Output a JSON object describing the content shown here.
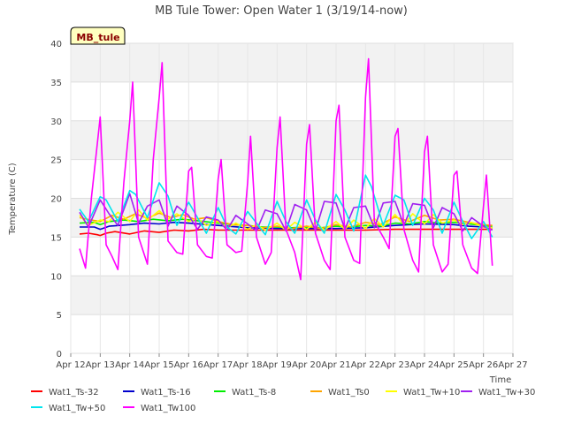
{
  "chart_data": {
    "type": "line",
    "title": "MB Tule Tower: Open Water 1 (3/19/14-now)",
    "xlabel": "Time",
    "ylabel": "Temperature (C)",
    "ylim": [
      0,
      40
    ],
    "xlim": [
      12,
      27
    ],
    "y_ticks": [
      "0",
      "5",
      "10",
      "15",
      "20",
      "25",
      "30",
      "35",
      "40"
    ],
    "x_ticks": [
      "Apr 12",
      "Apr 13",
      "Apr 14",
      "Apr 15",
      "Apr 16",
      "Apr 17",
      "Apr 18",
      "Apr 19",
      "Apr 20",
      "Apr 21",
      "Apr 22",
      "Apr 23",
      "Apr 24",
      "Apr 25",
      "Apr 26",
      "Apr 27"
    ],
    "station_label": "MB_tule",
    "grid": true,
    "legend_position": "bottom",
    "series": [
      {
        "name": "Wat1_Ts-32",
        "color": "#ff0000",
        "x": [
          12.3,
          12.6,
          12.9,
          13.0,
          13.2,
          13.5,
          14.0,
          14.5,
          15.0,
          15.5,
          16.0,
          16.5,
          17.0,
          18.0,
          19.0,
          20.0,
          21.0,
          22.0,
          23.0,
          24.0,
          25.0,
          25.5,
          26.0,
          26.3
        ],
        "y": [
          15.4,
          15.5,
          15.3,
          15.2,
          15.5,
          15.7,
          15.4,
          15.8,
          15.6,
          15.9,
          15.8,
          16.0,
          15.9,
          15.9,
          15.9,
          15.9,
          15.9,
          15.9,
          16.0,
          16.0,
          16.0,
          16.0,
          16.0,
          16.0
        ]
      },
      {
        "name": "Wat1_Ts-16",
        "color": "#0000cc",
        "x": [
          12.3,
          12.8,
          13.0,
          13.3,
          14.0,
          14.5,
          15.0,
          15.5,
          16.0,
          17.0,
          18.0,
          19.0,
          20.0,
          21.0,
          22.0,
          23.0,
          24.0,
          25.0,
          25.5,
          26.0,
          26.3
        ],
        "y": [
          16.3,
          16.3,
          16.0,
          16.4,
          16.6,
          16.8,
          16.7,
          16.9,
          16.8,
          16.5,
          16.2,
          16.1,
          16.1,
          16.1,
          16.2,
          16.5,
          16.7,
          16.6,
          16.4,
          16.3,
          16.2
        ]
      },
      {
        "name": "Wat1_Ts-8",
        "color": "#00ee00",
        "x": [
          12.3,
          12.8,
          13.0,
          13.3,
          13.8,
          14.3,
          14.8,
          15.3,
          15.8,
          16.3,
          17.0,
          17.5,
          18.0,
          18.5,
          19.0,
          19.5,
          20.0,
          20.5,
          21.0,
          21.5,
          22.0,
          22.5,
          23.0,
          23.5,
          24.0,
          24.5,
          25.0,
          25.5,
          26.0,
          26.3
        ],
        "y": [
          16.8,
          16.9,
          16.6,
          17.0,
          17.2,
          17.0,
          17.3,
          17.1,
          17.3,
          17.1,
          16.8,
          16.6,
          16.5,
          16.3,
          16.3,
          16.2,
          16.3,
          16.2,
          16.4,
          16.3,
          16.5,
          16.4,
          16.8,
          16.7,
          17.0,
          16.8,
          16.9,
          16.7,
          16.5,
          16.4
        ]
      },
      {
        "name": "Wat1_Ts0",
        "color": "#ffa500",
        "x": [
          12.3,
          12.7,
          13.0,
          13.4,
          13.8,
          14.2,
          14.6,
          15.0,
          15.4,
          15.8,
          16.2,
          16.6,
          17.0,
          17.5,
          18.0,
          18.5,
          19.0,
          19.5,
          20.0,
          20.5,
          21.0,
          21.5,
          22.0,
          22.5,
          23.0,
          23.5,
          24.0,
          24.5,
          25.0,
          25.5,
          26.0,
          26.3
        ],
        "y": [
          17.5,
          17.2,
          17.0,
          17.8,
          17.3,
          18.0,
          17.4,
          18.1,
          17.5,
          17.9,
          17.3,
          17.5,
          17.0,
          16.6,
          16.5,
          16.2,
          16.4,
          16.1,
          16.4,
          16.1,
          16.6,
          16.3,
          16.9,
          16.6,
          17.6,
          17.0,
          17.8,
          17.2,
          17.3,
          16.9,
          16.6,
          16.5
        ]
      },
      {
        "name": "Wat1_Tw+10",
        "color": "#ffff00",
        "x": [
          12.3,
          12.6,
          13.0,
          13.3,
          13.6,
          14.0,
          14.3,
          14.6,
          15.0,
          15.3,
          15.6,
          16.0,
          16.3,
          16.6,
          17.0,
          17.3,
          17.6,
          18.0,
          18.3,
          18.6,
          19.0,
          19.3,
          19.6,
          20.0,
          20.3,
          20.6,
          21.0,
          21.3,
          21.6,
          22.0,
          22.3,
          22.6,
          23.0,
          23.3,
          23.6,
          24.0,
          24.3,
          24.6,
          25.0,
          25.3,
          25.6,
          26.0,
          26.3
        ],
        "y": [
          17.8,
          16.5,
          17.2,
          17.0,
          18.2,
          17.0,
          18.5,
          17.2,
          18.4,
          17.3,
          18.0,
          17.0,
          17.4,
          16.5,
          17.0,
          16.2,
          16.8,
          16.0,
          16.6,
          15.9,
          16.8,
          15.9,
          16.9,
          16.0,
          16.9,
          15.9,
          17.0,
          16.0,
          17.2,
          16.1,
          17.4,
          16.3,
          17.9,
          16.6,
          18.0,
          16.7,
          17.9,
          16.8,
          17.2,
          16.6,
          16.9,
          16.3,
          16.2
        ]
      },
      {
        "name": "Wat1_Tw+30",
        "color": "#a020f0",
        "x": [
          12.3,
          12.6,
          13.0,
          13.3,
          13.6,
          14.0,
          14.3,
          14.6,
          15.0,
          15.3,
          15.6,
          16.0,
          16.3,
          16.6,
          17.0,
          17.3,
          17.6,
          18.0,
          18.3,
          18.6,
          19.0,
          19.3,
          19.6,
          20.0,
          20.3,
          20.6,
          21.0,
          21.3,
          21.6,
          22.0,
          22.3,
          22.6,
          23.0,
          23.3,
          23.6,
          24.0,
          24.3,
          24.6,
          25.0,
          25.3,
          25.6,
          26.0,
          26.3
        ],
        "y": [
          18.2,
          16.3,
          19.8,
          18.0,
          16.5,
          20.6,
          16.8,
          19.0,
          19.8,
          16.4,
          19.0,
          17.8,
          16.0,
          17.6,
          17.2,
          15.9,
          17.8,
          16.7,
          15.8,
          18.5,
          18.0,
          15.8,
          19.2,
          18.5,
          15.8,
          19.6,
          19.4,
          16.0,
          18.8,
          19.0,
          16.2,
          19.4,
          19.6,
          16.5,
          19.3,
          19.1,
          16.2,
          18.8,
          18.0,
          15.8,
          17.5,
          16.4,
          15.9
        ]
      },
      {
        "name": "Wat1_Tw+50",
        "color": "#00e5ee",
        "x": [
          12.3,
          12.6,
          13.0,
          13.2,
          13.6,
          14.0,
          14.2,
          14.6,
          15.0,
          15.3,
          15.6,
          16.0,
          16.3,
          16.6,
          17.0,
          17.3,
          17.6,
          18.0,
          18.3,
          18.6,
          19.0,
          19.3,
          19.6,
          20.0,
          20.3,
          20.6,
          21.0,
          21.3,
          21.6,
          22.0,
          22.2,
          22.6,
          23.0,
          23.3,
          23.6,
          24.0,
          24.3,
          24.6,
          25.0,
          25.3,
          25.6,
          26.0,
          26.3
        ],
        "y": [
          18.6,
          17.0,
          20.2,
          19.8,
          17.0,
          21.0,
          20.5,
          17.5,
          22.0,
          20.3,
          16.5,
          19.5,
          17.5,
          15.5,
          18.8,
          16.3,
          15.4,
          18.3,
          16.8,
          15.3,
          19.6,
          17.0,
          15.5,
          19.8,
          17.2,
          15.5,
          20.5,
          18.5,
          15.8,
          23.0,
          21.5,
          16.5,
          20.4,
          19.8,
          16.5,
          20.0,
          18.5,
          15.5,
          19.5,
          17.0,
          14.8,
          17.0,
          15.0
        ]
      },
      {
        "name": "Wat1_Tw100",
        "color": "#ff00ff",
        "x": [
          12.3,
          12.5,
          12.7,
          12.9,
          13.0,
          13.2,
          13.4,
          13.6,
          13.8,
          14.0,
          14.1,
          14.3,
          14.6,
          14.8,
          15.0,
          15.1,
          15.3,
          15.6,
          15.8,
          16.0,
          16.1,
          16.3,
          16.6,
          16.8,
          17.0,
          17.1,
          17.3,
          17.6,
          17.8,
          18.0,
          18.1,
          18.3,
          18.6,
          18.8,
          19.0,
          19.1,
          19.3,
          19.6,
          19.8,
          20.0,
          20.1,
          20.3,
          20.6,
          20.8,
          21.0,
          21.1,
          21.3,
          21.6,
          21.8,
          22.0,
          22.1,
          22.3,
          22.6,
          22.8,
          23.0,
          23.1,
          23.3,
          23.6,
          23.8,
          24.0,
          24.1,
          24.3,
          24.6,
          24.8,
          25.0,
          25.1,
          25.3,
          25.6,
          25.8,
          26.0,
          26.1,
          26.3
        ],
        "y": [
          13.5,
          11.0,
          20.0,
          27.0,
          30.5,
          14.0,
          12.5,
          10.8,
          22.0,
          30.0,
          35.0,
          15.0,
          11.5,
          25.0,
          33.0,
          37.5,
          14.5,
          13.0,
          12.8,
          23.5,
          24.0,
          14.0,
          12.5,
          12.3,
          22.5,
          25.0,
          14.0,
          13.0,
          13.2,
          22.0,
          28.0,
          15.0,
          11.5,
          13.0,
          26.5,
          30.5,
          16.0,
          13.0,
          9.5,
          27.0,
          29.5,
          15.5,
          12.0,
          10.8,
          30.0,
          32.0,
          15.0,
          12.0,
          11.6,
          33.0,
          38.0,
          17.0,
          15.0,
          13.5,
          28.0,
          29.0,
          16.0,
          12.0,
          10.5,
          26.0,
          28.0,
          14.0,
          10.5,
          11.5,
          23.0,
          23.5,
          14.0,
          11.0,
          10.3,
          19.0,
          23.0,
          11.3
        ]
      }
    ]
  }
}
